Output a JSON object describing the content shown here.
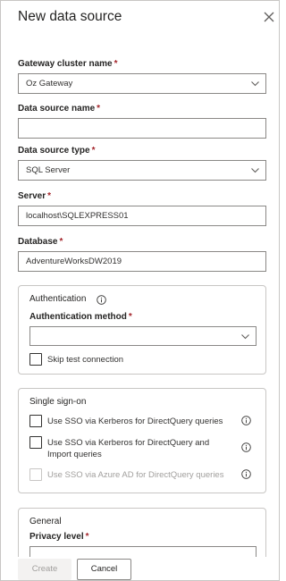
{
  "dialog": {
    "title": "New data source"
  },
  "form": {
    "gateway_cluster": {
      "label": "Gateway cluster name",
      "required_mark": "*",
      "value": "Oz Gateway"
    },
    "data_source_name": {
      "label": "Data source name",
      "required_mark": "*",
      "value": ""
    },
    "data_source_type": {
      "label": "Data source type",
      "required_mark": "*",
      "value": "SQL Server"
    },
    "server": {
      "label": "Server",
      "required_mark": "*",
      "value": "localhost\\SQLEXPRESS01"
    },
    "database": {
      "label": "Database",
      "required_mark": "*",
      "value": "AdventureWorksDW2019"
    }
  },
  "authentication": {
    "heading": "Authentication",
    "method_label": "Authentication method",
    "required_mark": "*",
    "method_value": "",
    "skip_test_label": "Skip test connection"
  },
  "sso": {
    "heading": "Single sign-on",
    "options": [
      {
        "label": "Use SSO via Kerberos for DirectQuery queries",
        "enabled": true
      },
      {
        "label": "Use SSO via Kerberos for DirectQuery and Import queries",
        "enabled": true
      },
      {
        "label": "Use SSO via Azure AD for DirectQuery queries",
        "enabled": false
      }
    ]
  },
  "general": {
    "heading": "General",
    "privacy_label": "Privacy level",
    "required_mark": "*"
  },
  "footer": {
    "create_label": "Create",
    "cancel_label": "Cancel"
  },
  "icons": {
    "close": "close-icon",
    "chevron": "chevron-down-icon",
    "info": "info-icon"
  }
}
